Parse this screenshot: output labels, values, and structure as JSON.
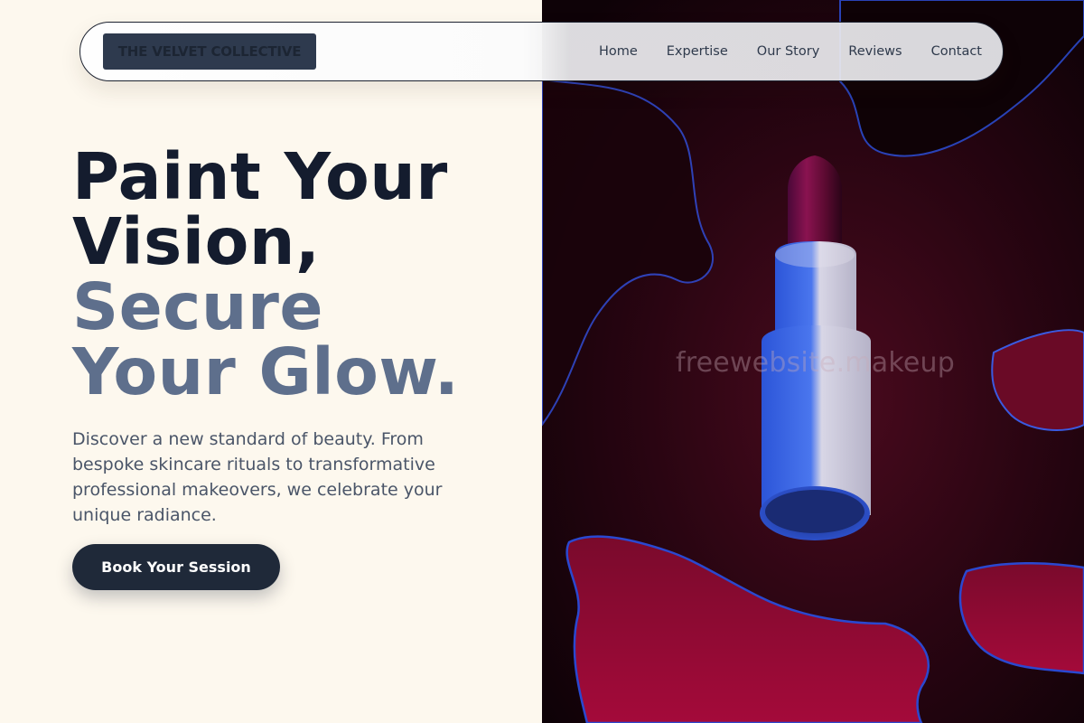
{
  "brand": {
    "name": "THE VELVET COLLECTIVE"
  },
  "nav": {
    "items": [
      {
        "label": "Home"
      },
      {
        "label": "Expertise"
      },
      {
        "label": "Our Story"
      },
      {
        "label": "Reviews"
      },
      {
        "label": "Contact"
      }
    ]
  },
  "hero": {
    "headline_line1": "Paint Your",
    "headline_line2": "Vision,",
    "headline_line3": "Secure",
    "headline_line4": "Your Glow.",
    "description": "Discover a new standard of beauty. From bespoke skincare rituals to transformative professional makeovers, we celebrate your unique radiance.",
    "cta_label": "Book Your Session"
  },
  "image": {
    "subject": "lipstick-image",
    "watermark": "freewebsite.makeup"
  },
  "colors": {
    "background": "#fdf8ee",
    "headline_dark": "#141c2e",
    "headline_muted": "#5e6f8c",
    "button": "#1f2939",
    "image_background": "#22040e"
  }
}
